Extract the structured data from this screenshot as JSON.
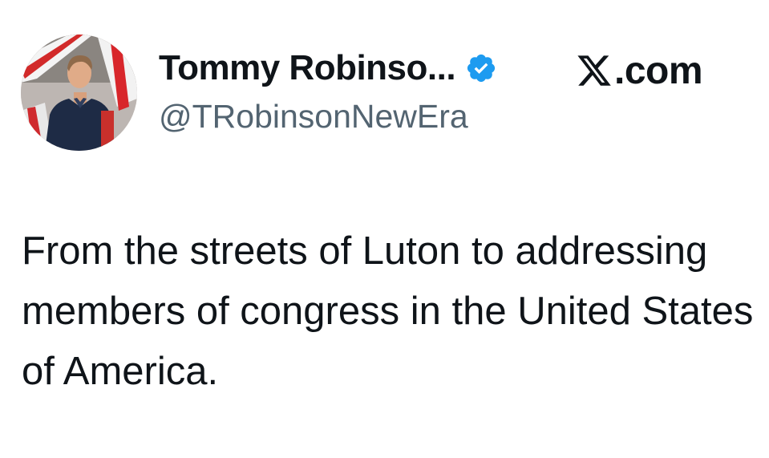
{
  "tweet": {
    "author": {
      "display_name": "Tommy Robinso...",
      "handle": "@TRobinsonNewEra",
      "verified": true,
      "avatar_icon": "profile-photo"
    },
    "source_label": ".com",
    "source_icon": "x-logo-icon",
    "text": "From the streets of Luton to addressing members of congress in the United States of America."
  },
  "colors": {
    "text": "#0f1419",
    "secondary": "#536471",
    "verified_badge": "#1d9bf0",
    "background": "#ffffff"
  }
}
